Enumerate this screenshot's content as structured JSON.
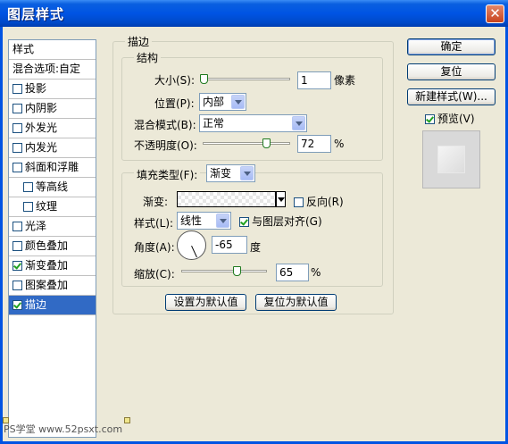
{
  "window": {
    "title": "图层样式",
    "close": "✕"
  },
  "styles_list": {
    "header": "样式",
    "blend_options": "混合选项:自定",
    "items": [
      {
        "label": "投影",
        "checked": false,
        "indent": false,
        "selected": false
      },
      {
        "label": "内阴影",
        "checked": false,
        "indent": false,
        "selected": false
      },
      {
        "label": "外发光",
        "checked": false,
        "indent": false,
        "selected": false
      },
      {
        "label": "内发光",
        "checked": false,
        "indent": false,
        "selected": false
      },
      {
        "label": "斜面和浮雕",
        "checked": false,
        "indent": false,
        "selected": false
      },
      {
        "label": "等高线",
        "checked": false,
        "indent": true,
        "selected": false
      },
      {
        "label": "纹理",
        "checked": false,
        "indent": true,
        "selected": false
      },
      {
        "label": "光泽",
        "checked": false,
        "indent": false,
        "selected": false
      },
      {
        "label": "颜色叠加",
        "checked": false,
        "indent": false,
        "selected": false
      },
      {
        "label": "渐变叠加",
        "checked": true,
        "indent": false,
        "selected": false
      },
      {
        "label": "图案叠加",
        "checked": false,
        "indent": false,
        "selected": false
      },
      {
        "label": "描边",
        "checked": true,
        "indent": false,
        "selected": true
      }
    ]
  },
  "stroke": {
    "section_title": "描边",
    "structure": {
      "title": "结构",
      "size_label": "大小(S):",
      "size_value": "1",
      "size_unit": "像素",
      "size_level": 0.01,
      "position_label": "位置(P):",
      "position_value": "内部",
      "blend_mode_label": "混合模式(B):",
      "blend_mode_value": "正常",
      "opacity_label": "不透明度(O):",
      "opacity_value": "72",
      "opacity_unit": "%",
      "opacity_level": 0.72
    },
    "fill": {
      "fill_type_label": "填充类型(F):",
      "fill_type_value": "渐变",
      "gradient_label": "渐变:",
      "reverse_label": "反向(R)",
      "reverse_checked": false,
      "style_label": "样式(L):",
      "style_value": "线性",
      "align_label": "与图层对齐(G)",
      "align_checked": true,
      "angle_label": "角度(A):",
      "angle_value": "-65",
      "angle_unit": "度",
      "scale_label": "缩放(C):",
      "scale_value": "65",
      "scale_unit": "%",
      "scale_level": 0.65
    },
    "set_default": "设置为默认值",
    "reset_default": "复位为默认值"
  },
  "right": {
    "ok": "确定",
    "reset": "复位",
    "new_style": "新建样式(W)...",
    "preview_label": "预览(V)",
    "preview_checked": true
  },
  "watermark": "PS学堂 www.52psxt.com"
}
